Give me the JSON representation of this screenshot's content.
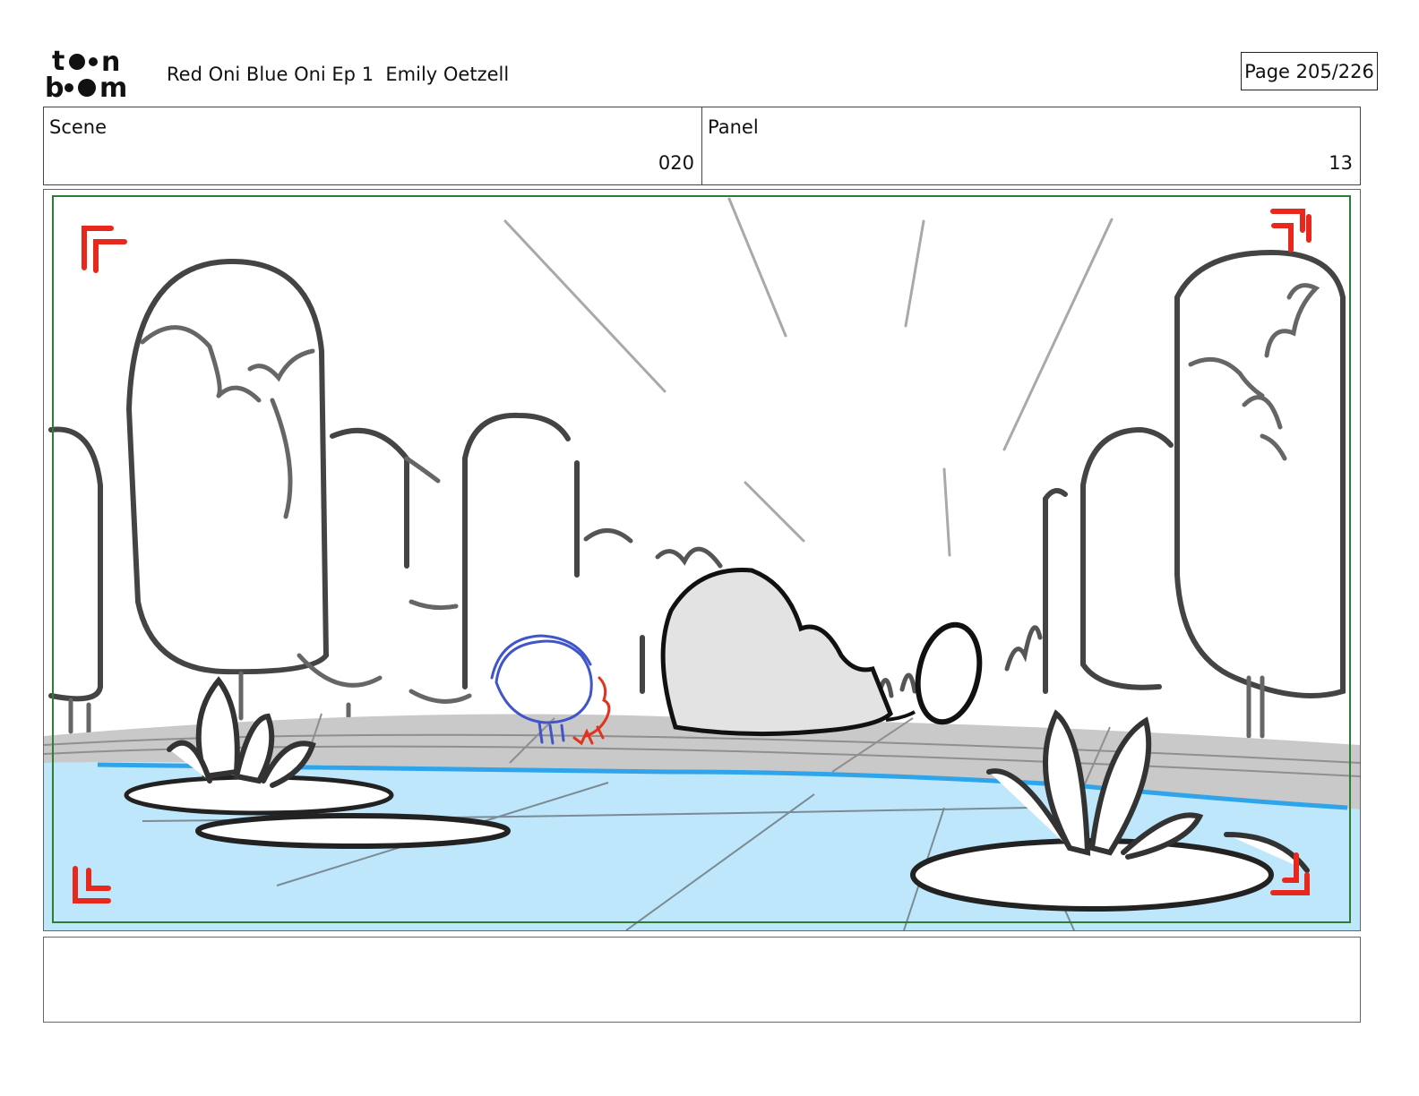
{
  "header": {
    "logo_alt": "toon boom",
    "project_title": "Red Oni Blue Oni Ep 1  Emily Oetzell",
    "page_label": "Page 205/226"
  },
  "info": {
    "scene_label": "Scene",
    "scene_value": "020",
    "panel_label": "Panel",
    "panel_value": "13"
  },
  "storyboard_panel": {
    "description_icon": "park-pond-sketch",
    "colors": {
      "water": "#bfe7fb",
      "water_edge": "#2fa4ea",
      "path": "#c9c9c9",
      "safe_frame": "#2e7d32",
      "corner_marks": "#e8281c",
      "blue_character": "#3f55c9",
      "red_character": "#e0341f"
    }
  },
  "notes": {
    "text": ""
  }
}
